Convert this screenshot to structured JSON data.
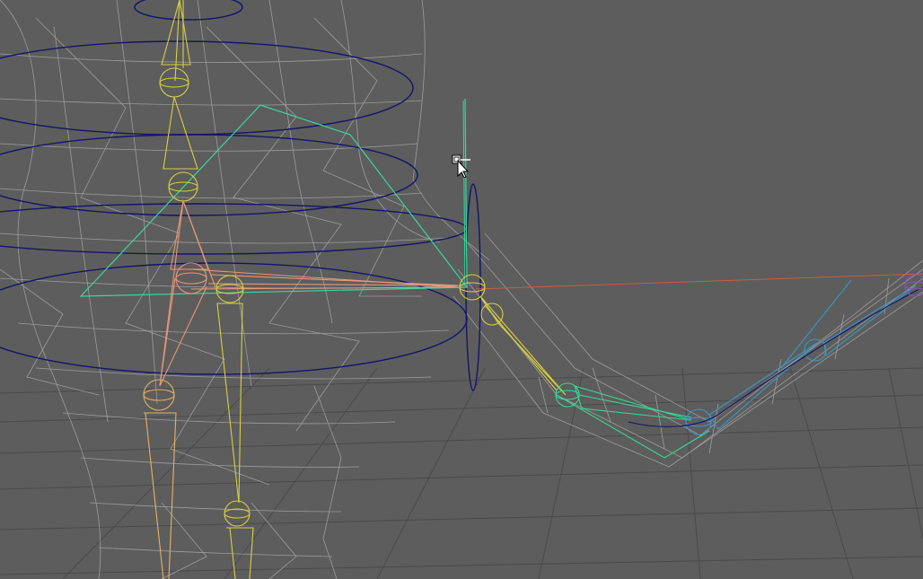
{
  "viewport": {
    "background": "#5d5d5d",
    "grid_color": "#4a4a4a",
    "mesh_color": "#a8a8a8",
    "colors": {
      "spine": "#d8d040",
      "pelvis": "#e89878",
      "leg_left": "#e8b060",
      "leg_right": "#d8d040",
      "shoulder_plane": "#38d8a0",
      "arm_upper": "#d8d040",
      "arm_lower": "#38d898",
      "hand": "#3898c8",
      "control_curve": "#14146a",
      "axis_x": "#c86040",
      "axis_y": "#38d898",
      "end_effector": "#9050c0"
    }
  },
  "cursor": {
    "icon": "arrow-with-move-box-icon"
  }
}
